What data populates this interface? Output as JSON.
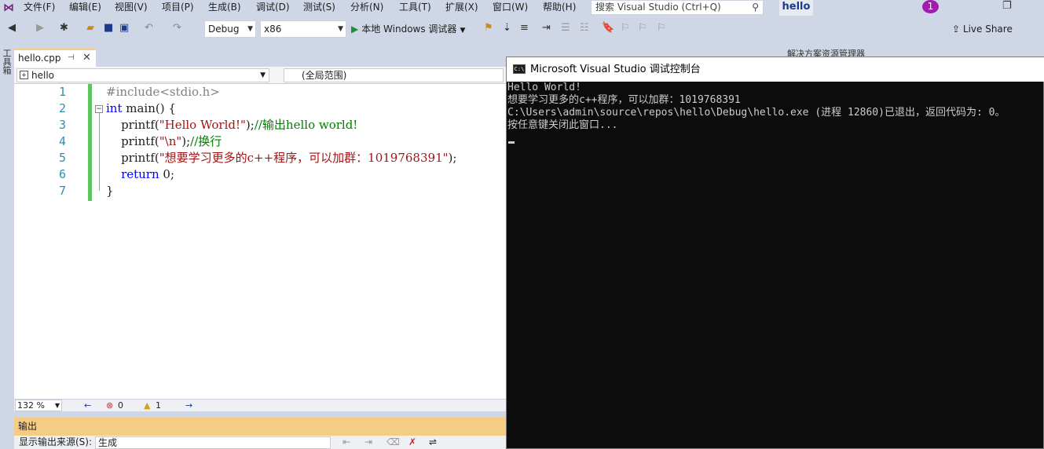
{
  "menu": {
    "items": [
      "文件(F)",
      "编辑(E)",
      "视图(V)",
      "项目(P)",
      "生成(B)",
      "调试(D)",
      "测试(S)",
      "分析(N)",
      "工具(T)",
      "扩展(X)",
      "窗口(W)",
      "帮助(H)"
    ]
  },
  "search": {
    "placeholder": "搜索 Visual Studio (Ctrl+Q)"
  },
  "solution_name": "hello",
  "notification_count": "1",
  "toolbar": {
    "config": "Debug",
    "platform": "x86",
    "run_label": "本地 Windows 调试器",
    "live_share": "Live Share"
  },
  "toolbox_label": "工具箱",
  "tab": {
    "filename": "hello.cpp"
  },
  "navbar": {
    "scope": "hello",
    "global": "(全局范围)"
  },
  "editor": {
    "line_numbers": [
      "1",
      "2",
      "3",
      "4",
      "5",
      "6",
      "7"
    ],
    "lines": [
      {
        "pp": "#include<stdio.h>"
      },
      {
        "kw": "int",
        "rest": " main() {"
      },
      {
        "pre": "    printf(",
        "str": "\"Hello World!\"",
        "post": ");",
        "cmt": "//输出hello world!"
      },
      {
        "pre": "    printf(",
        "str": "\"\\n\"",
        "post": ");",
        "cmt": "//换行"
      },
      {
        "pre": "    printf(",
        "str": "\"想要学习更多的c++程序，可以加群：1019768391\"",
        "post": ");"
      },
      {
        "kw": "    return",
        "rest": " 0;"
      },
      {
        "rest": "}"
      }
    ]
  },
  "status": {
    "zoom": "132 %",
    "errors": "0",
    "warnings": "1"
  },
  "output": {
    "title": "输出",
    "source_label": "显示输出来源(S):",
    "source_value": "生成"
  },
  "solution_panel_title": "解决方案资源管理器",
  "console": {
    "title": "Microsoft Visual Studio 调试控制台",
    "icon_text": "C:\\",
    "lines": [
      "Hello World!",
      "想要学习更多的c++程序，可以加群：1019768391",
      "C:\\Users\\admin\\source\\repos\\hello\\Debug\\hello.exe (进程 12860)已退出，返回代码为: 0。",
      "按任意键关闭此窗口..."
    ]
  }
}
